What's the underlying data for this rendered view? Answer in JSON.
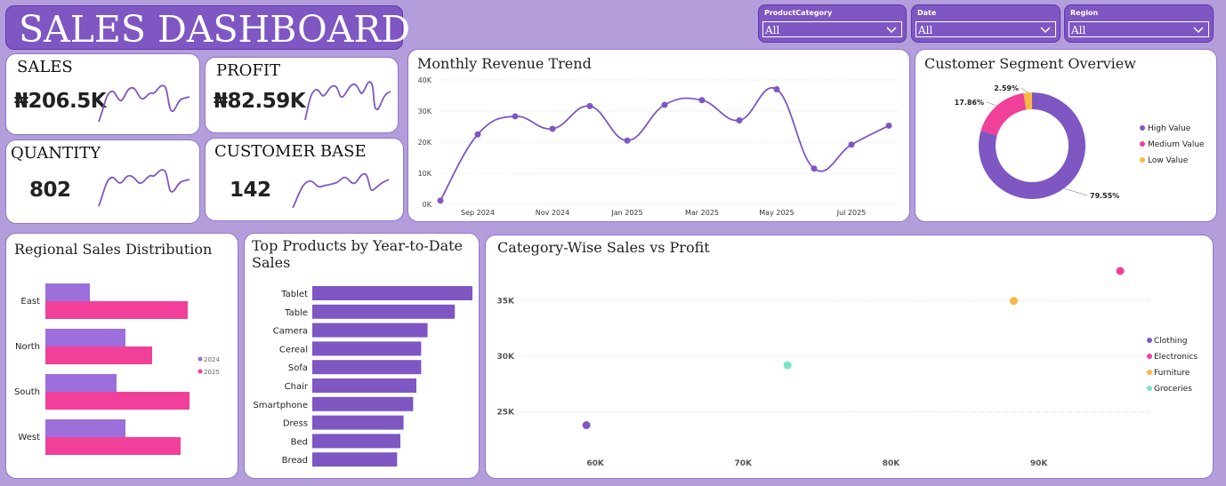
{
  "header": {
    "title": "SALES DASHBOARD"
  },
  "slicers": [
    {
      "label": "ProductCategory",
      "value": "All"
    },
    {
      "label": "Date",
      "value": "All"
    },
    {
      "label": "Region",
      "value": "All"
    }
  ],
  "kpis": {
    "sales": {
      "title": "SALES",
      "value": "₦206.5K"
    },
    "profit": {
      "title": "PROFIT",
      "value": "₦82.59K"
    },
    "quantity": {
      "title": "QUANTITY",
      "value": "802"
    },
    "customers": {
      "title": "CUSTOMER BASE",
      "value": "142"
    }
  },
  "colors": {
    "purple": "#7e57c2",
    "pink": "#f0409a",
    "orange": "#f7b844",
    "teal": "#7be3c8",
    "bg": "#b39ddb"
  },
  "chart_data": [
    {
      "id": "monthly_revenue",
      "type": "line",
      "title": "Monthly Revenue Trend",
      "x": [
        "Aug 2024",
        "Sep 2024",
        "Oct 2024",
        "Nov 2024",
        "Dec 2024",
        "Jan 2025",
        "Feb 2025",
        "Mar 2025",
        "Apr 2025",
        "May 2025",
        "Jun 2025",
        "Jul 2025",
        "Aug 2025"
      ],
      "x_tick_labels": [
        "Sep 2024",
        "Nov 2024",
        "Jan 2025",
        "Mar 2025",
        "May 2025",
        "Jul 2025"
      ],
      "values": [
        1200,
        22500,
        28300,
        24300,
        31600,
        20500,
        32000,
        33500,
        27000,
        37000,
        11500,
        19200,
        25300
      ],
      "ylim": [
        0,
        40000
      ],
      "y_ticks": [
        "0K",
        "10K",
        "20K",
        "30K",
        "40K"
      ],
      "grid": true
    },
    {
      "id": "customer_segment",
      "type": "pie",
      "title": "Customer Segment Overview",
      "labels": [
        "High Value",
        "Medium Value",
        "Low Value"
      ],
      "values": [
        79.55,
        17.86,
        2.59
      ],
      "value_labels": [
        "79.55%",
        "17.86%",
        "2.59%"
      ],
      "colors": [
        "#7e57c2",
        "#f0409a",
        "#f7b844"
      ],
      "legend": "right"
    },
    {
      "id": "regional_sales",
      "type": "bar",
      "title": "Regional Sales Distribution",
      "categories": [
        "East",
        "North",
        "South",
        "West"
      ],
      "series": [
        {
          "name": "2024",
          "values": [
            25,
            45,
            40,
            45
          ],
          "color": "#9c6fdb"
        },
        {
          "name": "2025",
          "values": [
            80,
            60,
            81,
            76
          ],
          "color": "#f0409a"
        }
      ],
      "legend": "right"
    },
    {
      "id": "top_products",
      "type": "bar",
      "title": "Top Products by Year-to-Date Sales",
      "categories": [
        "Tablet",
        "Table",
        "Camera",
        "Cereal",
        "Sofa",
        "Chair",
        "Smartphone",
        "Dress",
        "Bed",
        "Bread"
      ],
      "values": [
        100,
        89,
        72,
        68,
        68,
        65,
        63,
        57,
        55,
        53
      ],
      "color": "#7e57c2"
    },
    {
      "id": "category_scatter",
      "type": "scatter",
      "title": "Category-Wise Sales vs Profit",
      "series": [
        {
          "name": "Clothing",
          "x": 59400,
          "y": 23800,
          "color": "#7e57c2"
        },
        {
          "name": "Electronics",
          "x": 95500,
          "y": 37700,
          "color": "#f0409a"
        },
        {
          "name": "Furniture",
          "x": 88300,
          "y": 35000,
          "color": "#f7b844"
        },
        {
          "name": "Groceries",
          "x": 73000,
          "y": 29200,
          "color": "#7be3c8"
        }
      ],
      "x_ticks": [
        "60K",
        "70K",
        "80K",
        "90K"
      ],
      "y_ticks": [
        "25K",
        "30K",
        "35K"
      ],
      "xlim": [
        55000,
        97000
      ],
      "ylim": [
        22000,
        38500
      ],
      "legend": "right"
    }
  ]
}
